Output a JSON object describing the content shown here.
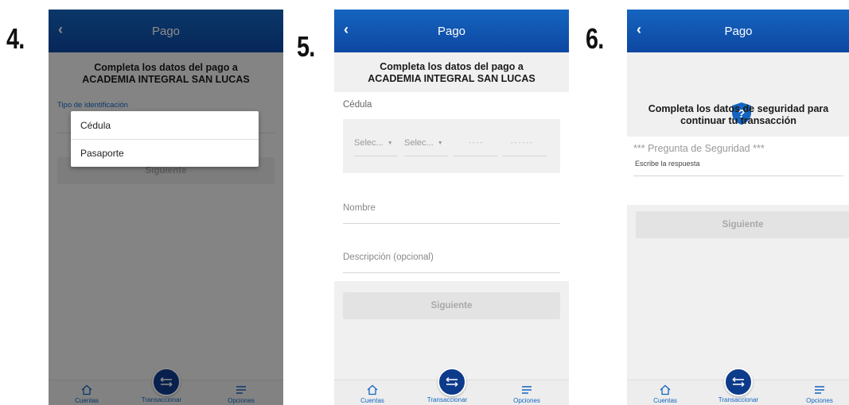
{
  "steps": [
    "4.",
    "5.",
    "6."
  ],
  "app": {
    "title": "Pago",
    "back_glyph": "‹",
    "header_line1": "Completa los datos del pago a",
    "header_line2": "ACADEMIA INTEGRAL SAN LUCAS",
    "next_label": "Siguiente"
  },
  "screen4": {
    "field_label": "Tipo de identificación",
    "options": [
      "Cédula",
      "Pasaporte"
    ]
  },
  "screen5": {
    "id_label": "Cédula",
    "select1": "Selec...",
    "select2": "Selec...",
    "mask1": "- - - -",
    "mask2": "- - - - - -",
    "name_placeholder": "Nombre",
    "description_placeholder": "Descripción (opcional)"
  },
  "screen6": {
    "security_line1": "Completa los datos de seguridad para",
    "security_line2": "continuar tu transacción",
    "question": "*** Pregunta de Seguridad ***",
    "answer_placeholder": "Escribe la respuesta"
  },
  "bottom_nav": {
    "left": "Cuentas",
    "center": "Transaccionar",
    "right": "Opciones"
  },
  "icons": {
    "back": "chevron-left-icon",
    "home": "home-icon",
    "transfer": "transfer-arrows-icon",
    "menu": "menu-lines-icon",
    "shield": "shield-question-icon",
    "caret": "caret-down-icon"
  },
  "colors": {
    "appbar_top": "#1565c0",
    "appbar_bottom": "#0d47a1",
    "fab": "#0d3b8c",
    "nav_text": "#1565c0"
  }
}
